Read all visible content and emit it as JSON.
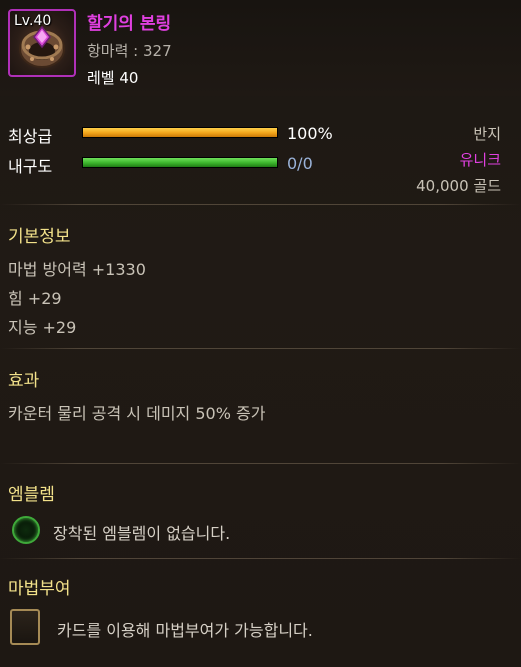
{
  "item": {
    "level_badge": "Lv.40",
    "name": "할기의 본링",
    "magic_resist": "항마력 : 327",
    "level": "레벨 40",
    "icon": "ring-icon"
  },
  "status": {
    "grade_label": "최상급",
    "grade_percent": "100%",
    "grade_fill": 1.0,
    "durability_label": "내구도",
    "durability_value": "0/0",
    "durability_fill": 1.0,
    "type": "반지",
    "rarity": "유니크",
    "price": "40,000 골드"
  },
  "basic_info": {
    "title": "기본정보",
    "stats": [
      "마법 방어력 +1330",
      "힘 +29",
      "지능 +29"
    ]
  },
  "effect": {
    "title": "효과",
    "text": "카운터 물리 공격 시 데미지 50% 증가"
  },
  "emblem": {
    "title": "엠블렘",
    "text": "장착된 엠블렘이 없습니다."
  },
  "enchant": {
    "title": "마법부여",
    "text": "카드를 이용해 마법부여가 가능합니다."
  },
  "colors": {
    "unique": "#e040e0",
    "section_title": "#f2e18a",
    "grade_bar": "#f2a41a",
    "durability_bar": "#3cb42c"
  }
}
